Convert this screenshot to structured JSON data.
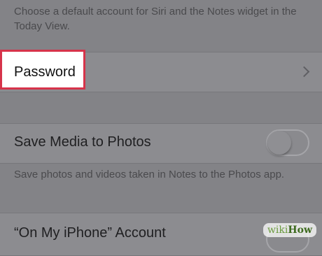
{
  "top_footnote": "Choose a default account for Siri and the Notes widget in the Today View.",
  "password_row": {
    "label": "Password"
  },
  "save_media_row": {
    "label": "Save Media to Photos",
    "toggle_on": false
  },
  "save_media_footnote": "Save photos and videos taken in Notes to the Photos app.",
  "on_my_iphone_row": {
    "label": "“On My iPhone” Account"
  },
  "watermark": {
    "wiki": "wiki",
    "how": "How"
  },
  "colors": {
    "highlight_border": "#d6334a",
    "background": "#838387"
  }
}
